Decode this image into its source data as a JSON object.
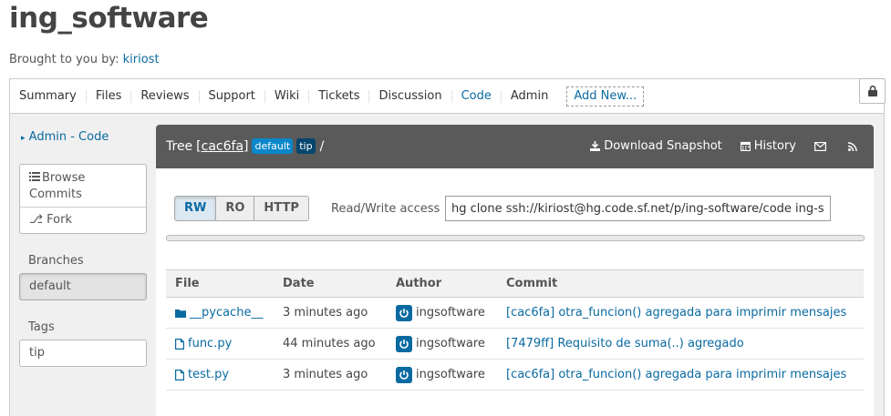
{
  "project": {
    "title": "ing_software",
    "brought_prefix": "Brought to you by:",
    "owner": "kiriost"
  },
  "nav": {
    "tabs": [
      "Summary",
      "Files",
      "Reviews",
      "Support",
      "Wiki",
      "Tickets",
      "Discussion",
      "Code",
      "Admin"
    ],
    "active_tab": "Code",
    "add_new": "Add New..."
  },
  "sidebar": {
    "admin_link": "Admin - Code",
    "browse_commits": "Browse Commits",
    "fork": "Fork",
    "branches_label": "Branches",
    "branch": "default",
    "tags_label": "Tags",
    "tag": "tip"
  },
  "header": {
    "tree_label": "Tree",
    "hash": "[cac6fa]",
    "badge_default": "default",
    "badge_tip": "tip",
    "path": "/",
    "download": "Download Snapshot",
    "history": "History"
  },
  "access": {
    "buttons": [
      "RW",
      "RO",
      "HTTP"
    ],
    "selected": "RW",
    "label": "Read/Write access",
    "clone_cmd": "hg clone ssh://kiriost@hg.code.sf.net/p/ing-software/code ing-software"
  },
  "table": {
    "columns": [
      "File",
      "Date",
      "Author",
      "Commit"
    ],
    "rows": [
      {
        "type": "folder",
        "name": "__pycache__",
        "date": "3 minutes ago",
        "author": "ingsoftware",
        "commit": "[cac6fa] otra_funcion() agregada para imprimir mensajes"
      },
      {
        "type": "file",
        "name": "func.py",
        "date": "44 minutes ago",
        "author": "ingsoftware",
        "commit": "[7479ff] Requisito de suma(..) agregado"
      },
      {
        "type": "file",
        "name": "test.py",
        "date": "3 minutes ago",
        "author": "ingsoftware",
        "commit": "[cac6fa] otra_funcion() agregada para imprimir mensajes"
      }
    ]
  },
  "icons": {
    "lock": "lock-icon",
    "list": "list-icon",
    "fork": "fork-icon",
    "download": "download-icon",
    "history": "calendar-icon",
    "mail": "mail-icon",
    "rss": "rss-icon",
    "folder": "folder-icon",
    "file": "file-icon",
    "avatar": "power-icon"
  },
  "colors": {
    "link": "#0a6aa1",
    "header_bg": "#5a5a5a",
    "badge_default": "#0a86c9",
    "badge_tip": "#06466e"
  }
}
